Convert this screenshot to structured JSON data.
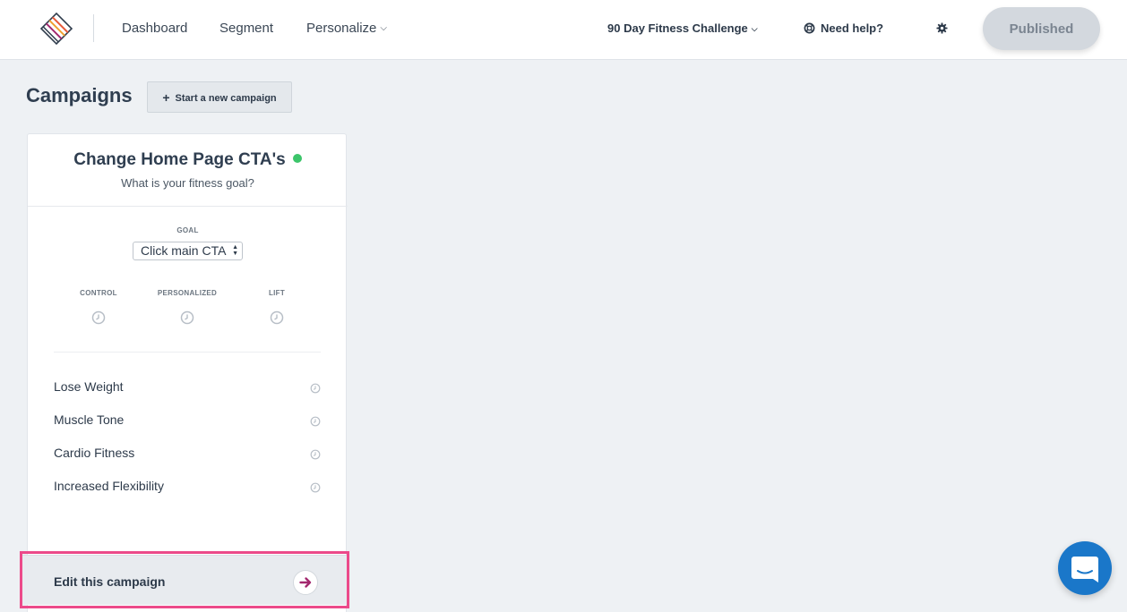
{
  "header": {
    "nav": [
      {
        "label": "Dashboard"
      },
      {
        "label": "Segment"
      },
      {
        "label": "Personalize"
      }
    ],
    "project": "90 Day Fitness Challenge",
    "help_label": "Need help?",
    "published_label": "Published"
  },
  "campaigns": {
    "title": "Campaigns",
    "new_button": "Start a new campaign"
  },
  "card": {
    "title": "Change Home Page CTA's",
    "subtitle": "What is your fitness goal?",
    "status_color": "#3cc56a",
    "goal_label": "GOAL",
    "goal_value": "Click main CTA",
    "metrics": [
      {
        "label": "CONTROL"
      },
      {
        "label": "PERSONALIZED"
      },
      {
        "label": "LIFT"
      }
    ],
    "segments": [
      {
        "label": "Lose Weight"
      },
      {
        "label": "Muscle Tone"
      },
      {
        "label": "Cardio Fitness"
      },
      {
        "label": "Increased Flexibility"
      }
    ],
    "edit_label": "Edit this campaign"
  },
  "colors": {
    "accent_pink": "#ec4a8a",
    "chat_blue": "#1a77c9",
    "arrow_purple": "#a3286e"
  }
}
